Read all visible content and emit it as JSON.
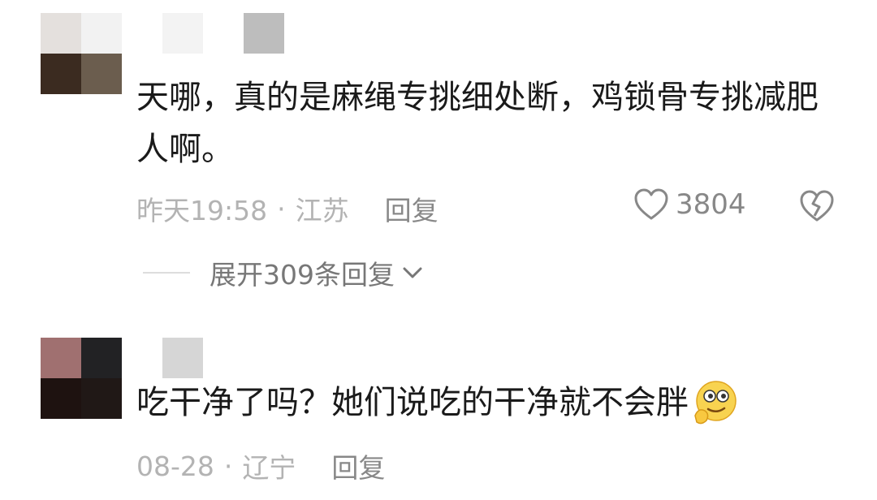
{
  "comments": [
    {
      "text_line1": "天哪，真的是麻绳专挑细处断，鸡锁骨专挑减肥",
      "text_line2": "人啊。",
      "time": "昨天19:58",
      "separator": "·",
      "location": "江苏",
      "reply_label": "回复",
      "likes": "3804",
      "expand_label": "展开309条回复",
      "avatar_icon": "pixelated-avatar",
      "username_icon": "pixelated-username"
    },
    {
      "text": "吃干净了吗？她们说吃的干净就不会胖",
      "emoji_icon": "thinking-face-emoji",
      "time": "08-28",
      "separator": "·",
      "location": "辽宁",
      "reply_label": "回复",
      "avatar_icon": "pixelated-avatar",
      "username_icon": "pixelated-username"
    }
  ],
  "colors": {
    "text": "#1a1a1a",
    "meta": "#b3b3b3",
    "action": "#888888"
  }
}
